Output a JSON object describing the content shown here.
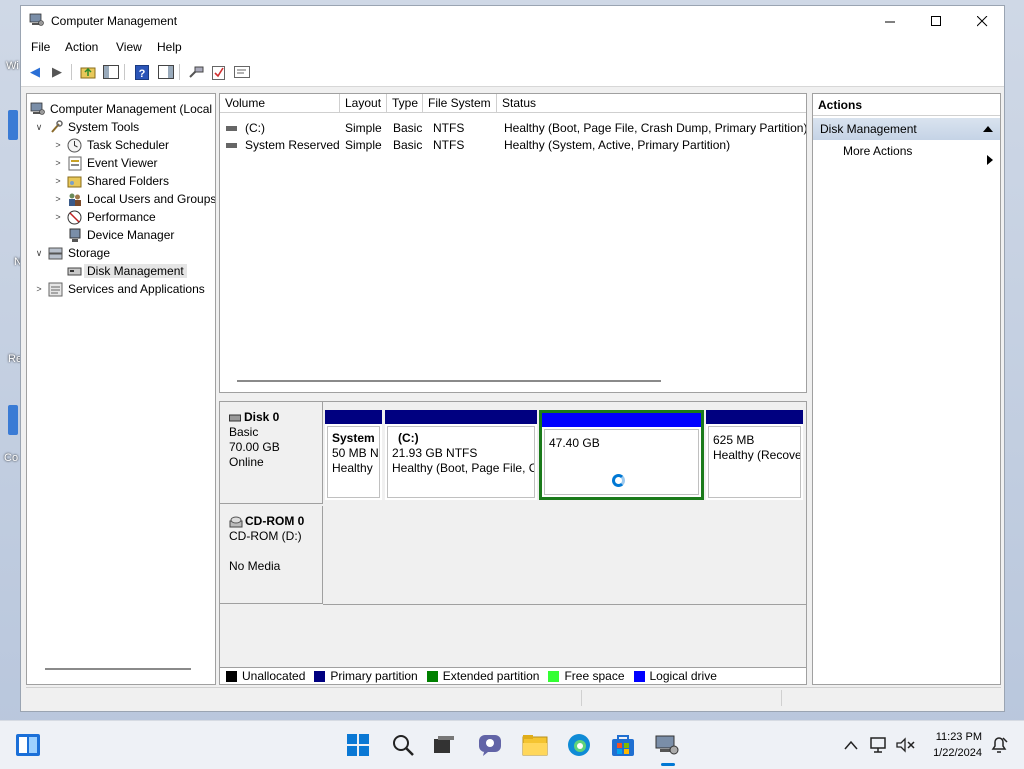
{
  "desktop": {
    "frag1": "Wi",
    "frag2": "N",
    "frag3": "Re",
    "frag4": "Co"
  },
  "window": {
    "title": "Computer Management",
    "menu": [
      "File",
      "Action",
      "View",
      "Help"
    ]
  },
  "tree": [
    {
      "label": "Computer Management (Local",
      "level": 0,
      "icon": "computer-management-icon",
      "twisty": ""
    },
    {
      "label": "System Tools",
      "level": 1,
      "icon": "system-tools-icon",
      "twisty": "v"
    },
    {
      "label": "Task Scheduler",
      "level": 2,
      "icon": "clock-icon",
      "twisty": ">"
    },
    {
      "label": "Event Viewer",
      "level": 2,
      "icon": "event-viewer-icon",
      "twisty": ">"
    },
    {
      "label": "Shared Folders",
      "level": 2,
      "icon": "shared-folder-icon",
      "twisty": ">"
    },
    {
      "label": "Local Users and Groups",
      "level": 2,
      "icon": "users-icon",
      "twisty": ">"
    },
    {
      "label": "Performance",
      "level": 2,
      "icon": "performance-icon",
      "twisty": ">"
    },
    {
      "label": "Device Manager",
      "level": 2,
      "icon": "device-manager-icon",
      "twisty": ""
    },
    {
      "label": "Storage",
      "level": 1,
      "icon": "storage-icon",
      "twisty": "v"
    },
    {
      "label": "Disk Management",
      "level": 2,
      "icon": "disk-icon",
      "twisty": ""
    },
    {
      "label": "Services and Applications",
      "level": 1,
      "icon": "services-icon",
      "twisty": ">"
    }
  ],
  "volumes": {
    "headers": [
      "Volume",
      "Layout",
      "Type",
      "File System",
      "Status"
    ],
    "rows": [
      [
        "(C:)",
        "Simple",
        "Basic",
        "NTFS",
        "Healthy (Boot, Page File, Crash Dump, Primary Partition)"
      ],
      [
        "System Reserved",
        "Simple",
        "Basic",
        "NTFS",
        "Healthy (System, Active, Primary Partition)"
      ]
    ]
  },
  "disks": {
    "disk0": {
      "name": "Disk 0",
      "type": "Basic",
      "size": "70.00 GB",
      "state": "Online"
    },
    "cdrom0": {
      "name": "CD-ROM 0",
      "drive": "CD-ROM (D:)",
      "media": "No Media"
    },
    "partitions": [
      {
        "title": "System",
        "line1": "50 MB N",
        "line2": "Healthy"
      },
      {
        "title": "(C:)",
        "line1": "21.93 GB NTFS",
        "line2": "Healthy (Boot, Page File, C"
      },
      {
        "title": "",
        "line1": "47.40 GB",
        "line2": ""
      },
      {
        "title": "",
        "line1": "625 MB",
        "line2": "Healthy (Recove"
      }
    ]
  },
  "legend": [
    {
      "label": "Unallocated",
      "color": "#000000"
    },
    {
      "label": "Primary partition",
      "color": "#000080"
    },
    {
      "label": "Extended partition",
      "color": "#008000"
    },
    {
      "label": "Free space",
      "color": "#33ff33"
    },
    {
      "label": "Logical drive",
      "color": "#0000ff"
    }
  ],
  "actions": {
    "header": "Actions",
    "section": "Disk Management",
    "more": "More Actions"
  },
  "clock": {
    "time": "11:23 PM",
    "date": "1/22/2024"
  }
}
